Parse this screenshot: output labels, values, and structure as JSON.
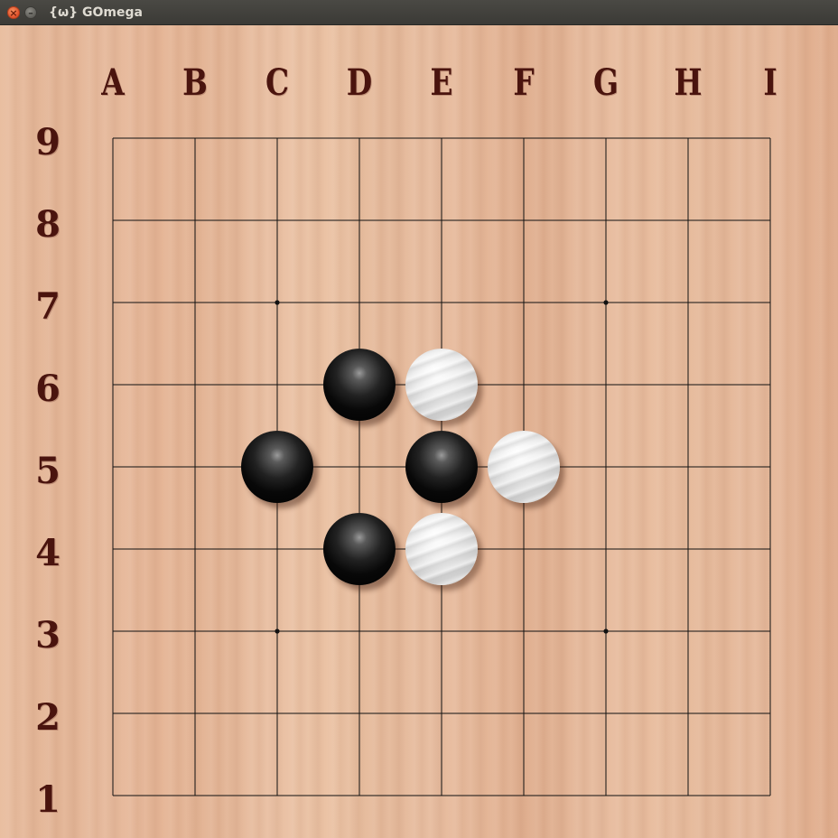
{
  "window": {
    "title": "{ω} GOmega",
    "close_glyph": "×",
    "minimize_glyph": "–"
  },
  "board": {
    "size": 9,
    "columns": [
      "A",
      "B",
      "C",
      "D",
      "E",
      "F",
      "G",
      "H",
      "I"
    ],
    "rows": [
      "9",
      "8",
      "7",
      "6",
      "5",
      "4",
      "3",
      "2",
      "1"
    ],
    "star_points": [
      "C7",
      "G7",
      "C3",
      "G3"
    ],
    "stones": [
      {
        "point": "D6",
        "color": "black"
      },
      {
        "point": "E6",
        "color": "white"
      },
      {
        "point": "C5",
        "color": "black"
      },
      {
        "point": "E5",
        "color": "black"
      },
      {
        "point": "F5",
        "color": "white"
      },
      {
        "point": "D4",
        "color": "black"
      },
      {
        "point": "E4",
        "color": "white"
      }
    ]
  },
  "colors": {
    "label": "#4a140e",
    "line": "#111111"
  }
}
